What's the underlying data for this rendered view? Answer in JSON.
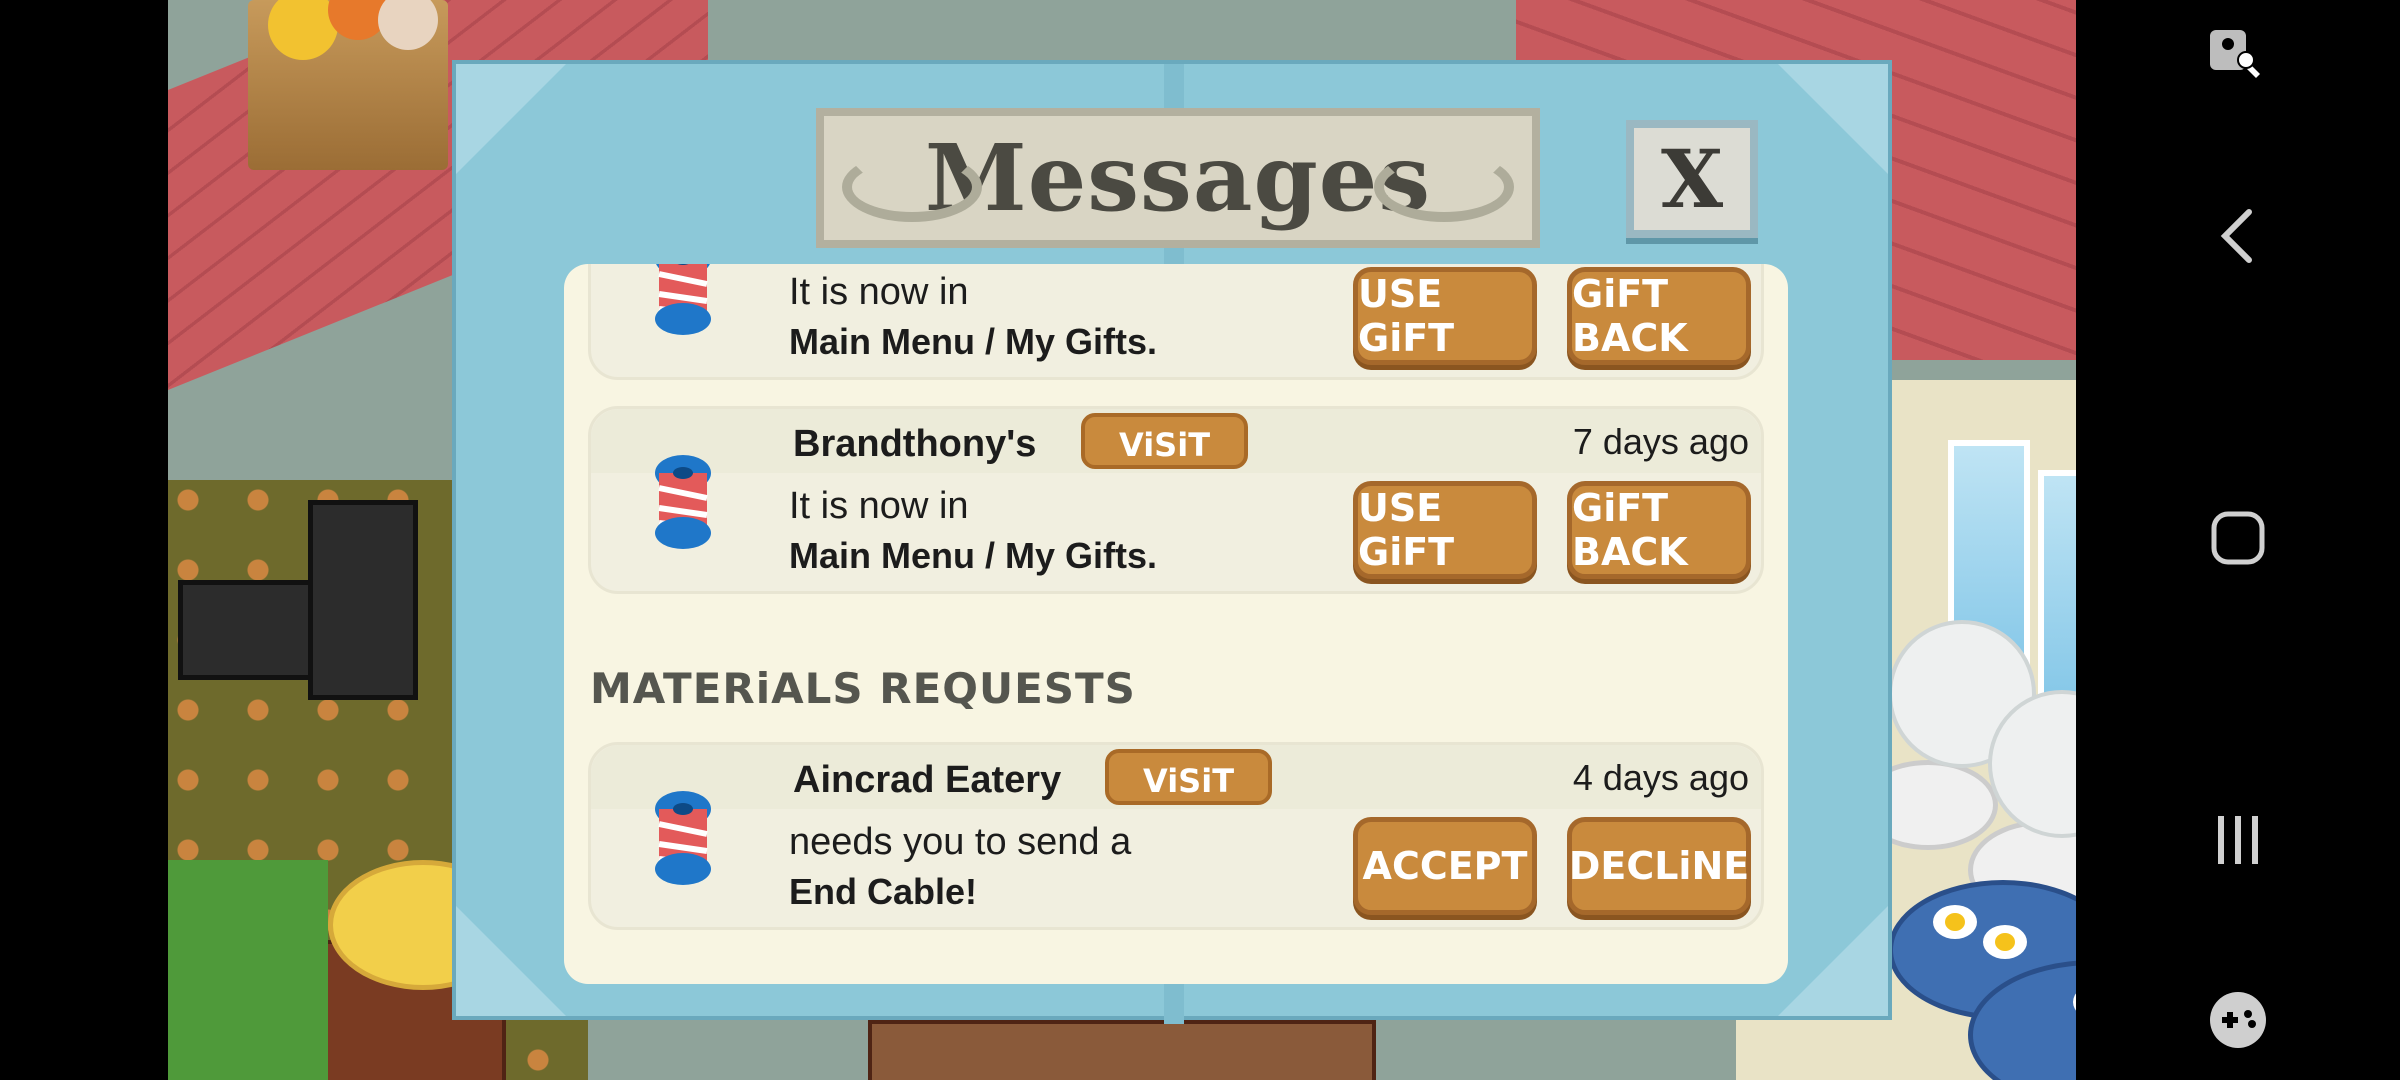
{
  "dialog": {
    "title": "Messages",
    "close_label": "X",
    "section_materials": "MATERiALS REQUESTS"
  },
  "gifts": [
    {
      "sender": "",
      "visit_label": "",
      "time_ago": "",
      "line1": "It is now in",
      "line2": "Main Menu / My Gifts.",
      "primary": "USE GiFT",
      "secondary": "GiFT BACK"
    },
    {
      "sender": "Brandthony's",
      "visit_label": "ViSiT",
      "time_ago": "7 days ago",
      "line1": "It is now in",
      "line2": "Main Menu / My Gifts.",
      "primary": "USE GiFT",
      "secondary": "GiFT BACK"
    }
  ],
  "requests": [
    {
      "sender": "Aincrad Eatery",
      "visit_label": "ViSiT",
      "time_ago": "4 days ago",
      "line1": "needs you to send a",
      "line2": "End Cable!",
      "primary": "ACCEPT",
      "secondary": "DECLiNE"
    }
  ],
  "icons": {
    "item": "spool-icon",
    "nav": [
      "accessibility-icon",
      "back-icon",
      "home-icon",
      "recents-icon",
      "game-launcher-icon"
    ]
  },
  "colors": {
    "button": "#c98a3d",
    "frame": "#8cc8d8",
    "panel": "#f8f5e2"
  }
}
